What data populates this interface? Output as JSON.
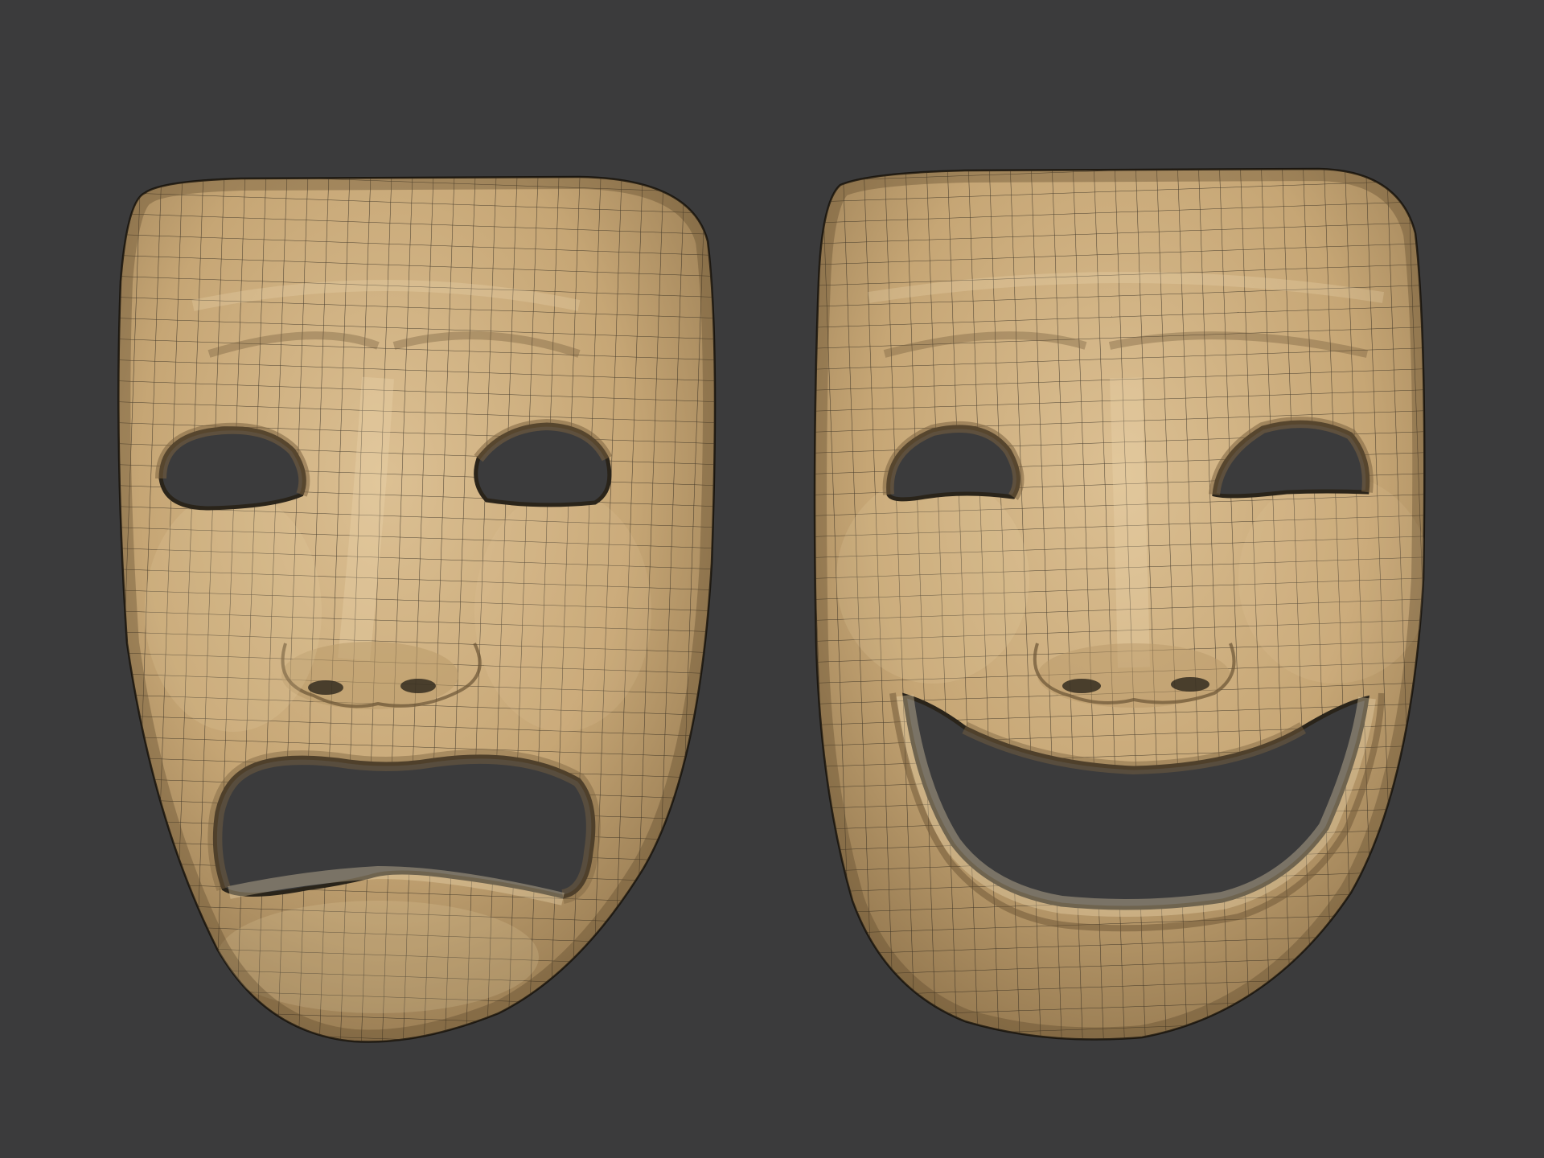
{
  "scene": {
    "background_color": "#3b3b3c",
    "mesh_color": "#c9ab7c",
    "wire_color": "#1e1a14",
    "masks": [
      {
        "name": "tragedy-mask",
        "expression": "sad"
      },
      {
        "name": "comedy-mask",
        "expression": "happy"
      }
    ]
  }
}
